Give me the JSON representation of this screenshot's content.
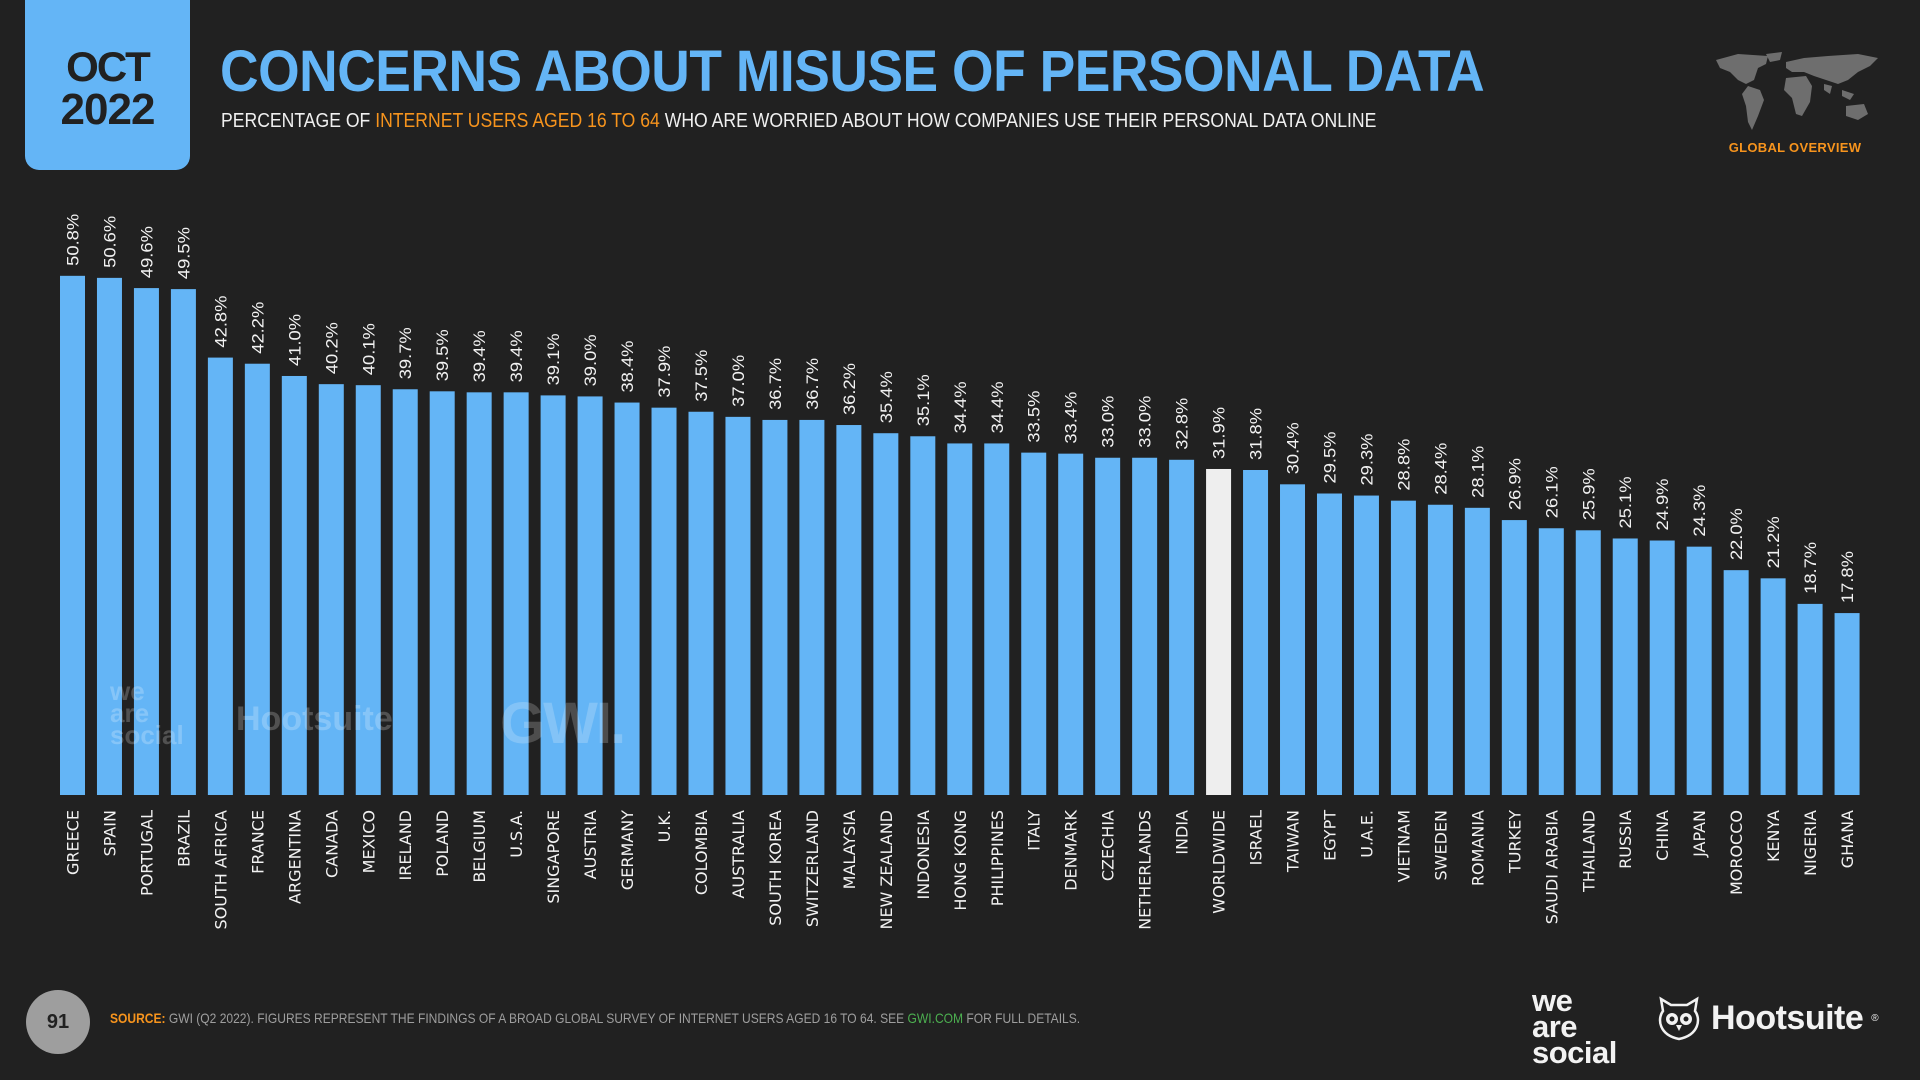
{
  "header": {
    "date_month": "OCT",
    "date_year": "2022",
    "title": "CONCERNS ABOUT MISUSE OF PERSONAL DATA",
    "subtitle_pre": "PERCENTAGE OF ",
    "subtitle_highlight": "INTERNET USERS AGED 16 TO 64",
    "subtitle_post": " WHO ARE WORRIED ABOUT HOW COMPANIES USE THEIR PERSONAL DATA ONLINE",
    "section_label": "GLOBAL OVERVIEW",
    "map_icon": "world-map-icon"
  },
  "colors": {
    "background": "#212121",
    "accent": "#64b5f6",
    "highlight_bar": "#eeeeee",
    "orange": "#f7941d",
    "link_green": "#4caf50"
  },
  "watermarks": {
    "we_are_social": "we are social",
    "hootsuite": "Hootsuite",
    "gwi": "GWI."
  },
  "footer": {
    "page_number": "91",
    "source_label": "SOURCE:",
    "source_text": " GWI (Q2 2022). FIGURES REPRESENT THE FINDINGS OF A BROAD GLOBAL SURVEY OF INTERNET USERS AGED 16 TO 64. SEE ",
    "source_link": "GWI.COM",
    "source_post": " FOR FULL DETAILS.",
    "logo_we_are_social": [
      "we",
      "are",
      "social"
    ],
    "logo_hootsuite": "Hootsuite",
    "logo_hootsuite_reg": "®"
  },
  "chart_data": {
    "type": "bar",
    "title": "CONCERNS ABOUT MISUSE OF PERSONAL DATA",
    "xlabel": "",
    "ylabel": "",
    "ylim": [
      0,
      50.8
    ],
    "grid": false,
    "legend": "none",
    "value_format": "percent-1dp",
    "highlight_category": "WORLDWIDE",
    "categories": [
      "GREECE",
      "SPAIN",
      "PORTUGAL",
      "BRAZIL",
      "SOUTH AFRICA",
      "FRANCE",
      "ARGENTINA",
      "CANADA",
      "MEXICO",
      "IRELAND",
      "POLAND",
      "BELGIUM",
      "U.S.A.",
      "SINGAPORE",
      "AUSTRIA",
      "GERMANY",
      "U.K.",
      "COLOMBIA",
      "AUSTRALIA",
      "SOUTH KOREA",
      "SWITZERLAND",
      "MALAYSIA",
      "NEW ZEALAND",
      "INDONESIA",
      "HONG KONG",
      "PHILIPPINES",
      "ITALY",
      "DENMARK",
      "CZECHIA",
      "NETHERLANDS",
      "INDIA",
      "WORLDWIDE",
      "ISRAEL",
      "TAIWAN",
      "EGYPT",
      "U.A.E.",
      "VIETNAM",
      "SWEDEN",
      "ROMANIA",
      "TURKEY",
      "SAUDI ARABIA",
      "THAILAND",
      "RUSSIA",
      "CHINA",
      "JAPAN",
      "MOROCCO",
      "KENYA",
      "NIGERIA",
      "GHANA"
    ],
    "values": [
      50.8,
      50.6,
      49.6,
      49.5,
      42.8,
      42.2,
      41.0,
      40.2,
      40.1,
      39.7,
      39.5,
      39.4,
      39.4,
      39.1,
      39.0,
      38.4,
      37.9,
      37.5,
      37.0,
      36.7,
      36.7,
      36.2,
      35.4,
      35.1,
      34.4,
      34.4,
      33.5,
      33.4,
      33.0,
      33.0,
      32.8,
      31.9,
      31.8,
      30.4,
      29.5,
      29.3,
      28.8,
      28.4,
      28.1,
      26.9,
      26.1,
      25.9,
      25.1,
      24.9,
      24.3,
      22.0,
      21.2,
      18.7,
      17.8
    ],
    "labels": [
      "50.8%",
      "50.6%",
      "49.6%",
      "49.5%",
      "42.8%",
      "42.2%",
      "41.0%",
      "40.2%",
      "40.1%",
      "39.7%",
      "39.5%",
      "39.4%",
      "39.4%",
      "39.1%",
      "39.0%",
      "38.4%",
      "37.9%",
      "37.5%",
      "37.0%",
      "36.7%",
      "36.7%",
      "36.2%",
      "35.4%",
      "35.1%",
      "34.4%",
      "34.4%",
      "33.5%",
      "33.4%",
      "33.0%",
      "33.0%",
      "32.8%",
      "31.9%",
      "31.8%",
      "30.4%",
      "29.5%",
      "29.3%",
      "28.8%",
      "28.4%",
      "28.1%",
      "26.9%",
      "26.1%",
      "25.9%",
      "25.1%",
      "24.9%",
      "24.3%",
      "22.0%",
      "21.2%",
      "18.7%",
      "17.8%"
    ]
  }
}
